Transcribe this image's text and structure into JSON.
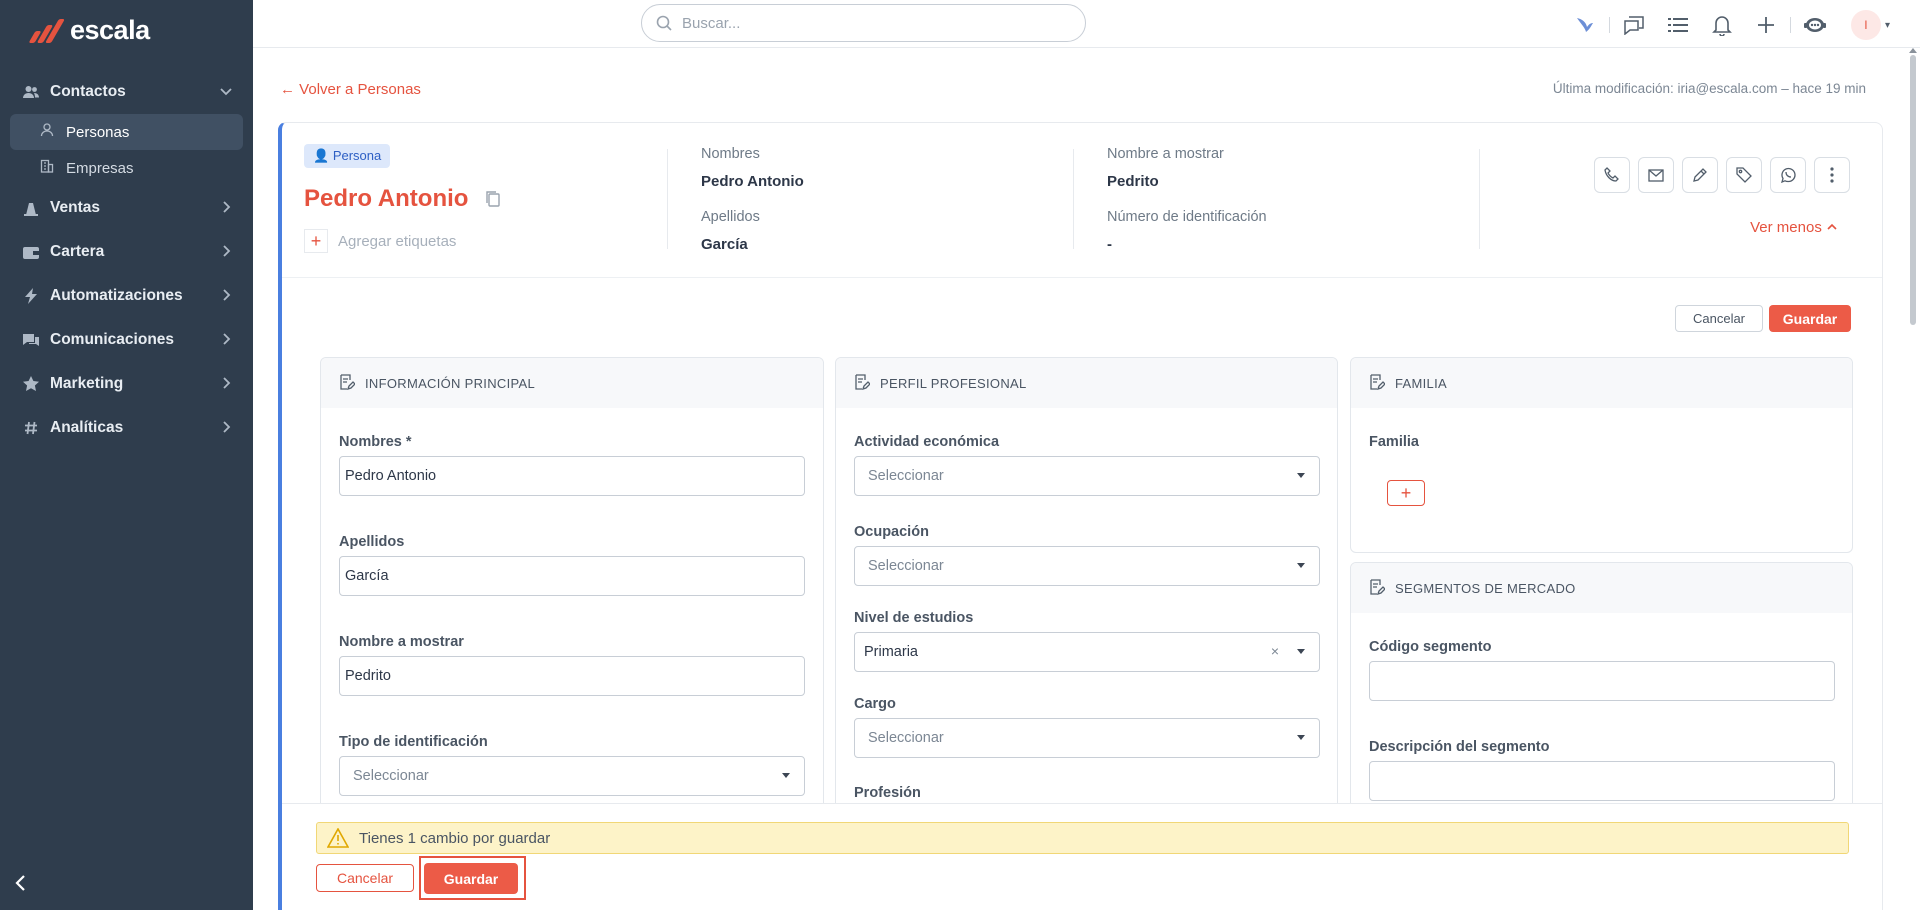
{
  "brand": {
    "name": "escala",
    "accent": "#e5533f",
    "sidebar_bg": "#2f3d4d",
    "link_blue": "#4a7fe0"
  },
  "sidebar": {
    "items": [
      {
        "label": "Contactos",
        "icon": "users-icon",
        "expanded": true
      },
      {
        "label": "Ventas",
        "icon": "scale-icon"
      },
      {
        "label": "Cartera",
        "icon": "wallet-icon"
      },
      {
        "label": "Automatizaciones",
        "icon": "bolt-icon"
      },
      {
        "label": "Comunicaciones",
        "icon": "chat-icon"
      },
      {
        "label": "Marketing",
        "icon": "star-icon"
      },
      {
        "label": "Analíticas",
        "icon": "hash-icon"
      }
    ],
    "subitems": [
      {
        "label": "Personas",
        "icon": "person-icon",
        "active": true
      },
      {
        "label": "Empresas",
        "icon": "building-icon"
      }
    ]
  },
  "topbar": {
    "search_placeholder": "Buscar...",
    "avatar_initial": "I"
  },
  "page": {
    "back_label": "Volver a Personas",
    "last_modified": "Última modificación: iria@escala.com – hace 19 min"
  },
  "person": {
    "badge": "Persona",
    "name": "Pedro Antonio",
    "add_tags": "Agregar etiquetas",
    "fields": {
      "nombres_label": "Nombres",
      "nombres_value": "Pedro Antonio",
      "apellidos_label": "Apellidos",
      "apellidos_value": "García",
      "mostrar_label": "Nombre a mostrar",
      "mostrar_value": "Pedrito",
      "ident_label": "Número de identificación",
      "ident_value": "-"
    },
    "ver_menos": "Ver menos"
  },
  "actions": {
    "cancel": "Cancelar",
    "save": "Guardar"
  },
  "sections": {
    "principal": {
      "title": "INFORMACIÓN PRINCIPAL",
      "nombres_label": "Nombres *",
      "nombres_value": "Pedro Antonio",
      "apellidos_label": "Apellidos",
      "apellidos_value": "García",
      "mostrar_label": "Nombre a mostrar",
      "mostrar_value": "Pedrito",
      "tipo_label": "Tipo de identificación",
      "tipo_placeholder": "Seleccionar"
    },
    "perfil": {
      "title": "PERFIL PROFESIONAL",
      "actividad_label": "Actividad económica",
      "actividad_placeholder": "Seleccionar",
      "ocupacion_label": "Ocupación",
      "ocupacion_placeholder": "Seleccionar",
      "estudios_label": "Nivel de estudios",
      "estudios_value": "Primaria",
      "cargo_label": "Cargo",
      "cargo_placeholder": "Seleccionar",
      "profesion_label": "Profesión"
    },
    "familia": {
      "title": "FAMILIA",
      "label": "Familia"
    },
    "segmentos": {
      "title": "SEGMENTOS DE MERCADO",
      "codigo_label": "Código segmento",
      "codigo_value": "",
      "desc_label": "Descripción del segmento",
      "desc_value": ""
    }
  },
  "footer": {
    "warning": "Tienes 1 cambio por guardar",
    "cancel": "Cancelar",
    "save": "Guardar"
  }
}
